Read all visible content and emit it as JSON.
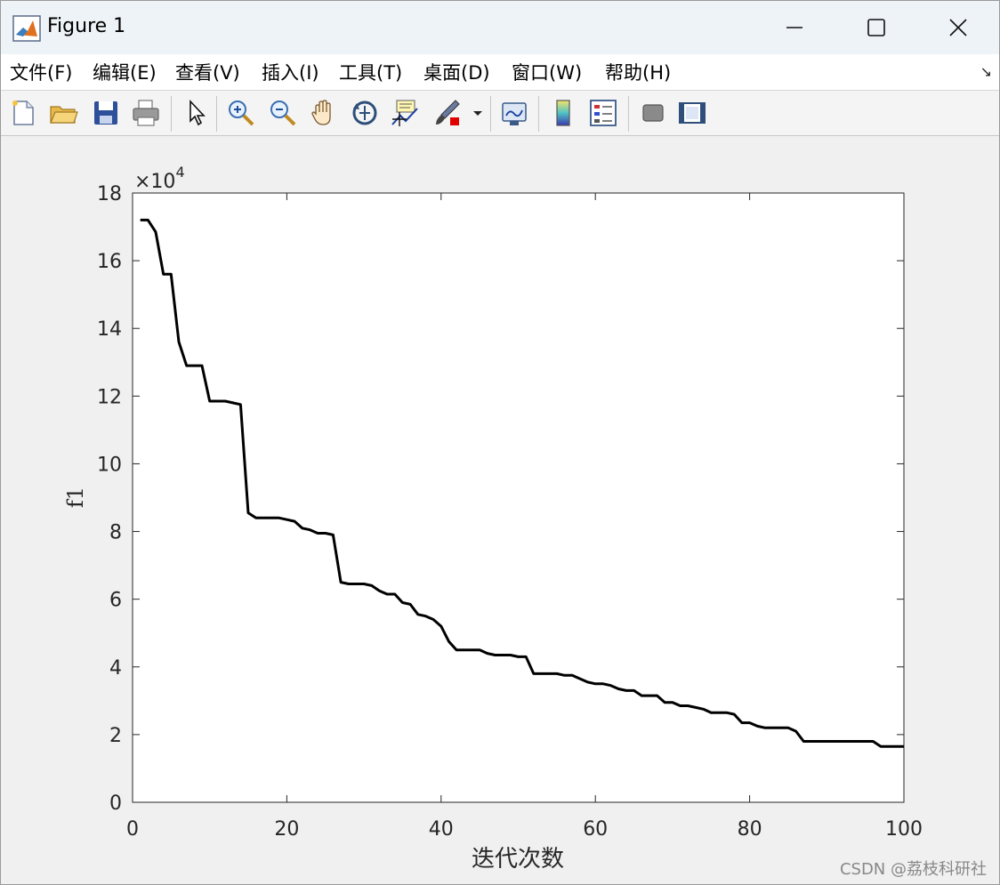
{
  "window": {
    "title": "Figure 1",
    "buttons": {
      "minimize": "minimize-icon",
      "maximize": "maximize-icon",
      "close": "close-icon"
    }
  },
  "menu": {
    "items": [
      {
        "label": "文件(F)"
      },
      {
        "label": "编辑(E)"
      },
      {
        "label": "查看(V)"
      },
      {
        "label": "插入(I)"
      },
      {
        "label": "工具(T)"
      },
      {
        "label": "桌面(D)"
      },
      {
        "label": "窗口(W)"
      },
      {
        "label": "帮助(H)"
      }
    ],
    "dock_arrow": "↘"
  },
  "toolbar": {
    "icons": [
      "new-file-icon",
      "open-folder-icon",
      "save-icon",
      "print-icon",
      "pointer-icon",
      "zoom-in-icon",
      "zoom-out-icon",
      "pan-hand-icon",
      "rotate-3d-icon",
      "data-cursor-icon",
      "brush-icon",
      "brush-dropdown-icon",
      "link-plot-icon",
      "colorbar-icon",
      "legend-icon",
      "hide-plot-tools-icon",
      "show-plot-tools-icon"
    ]
  },
  "chart_data": {
    "type": "line",
    "title": "",
    "xlabel": "迭代次数",
    "ylabel": "f1",
    "exponent_label": "×10",
    "exponent_power": "4",
    "xlim": [
      0,
      100
    ],
    "ylim": [
      0,
      18
    ],
    "xticks": [
      0,
      20,
      40,
      60,
      80,
      100
    ],
    "yticks": [
      0,
      2,
      4,
      6,
      8,
      10,
      12,
      14,
      16,
      18
    ],
    "line_color": "#000000",
    "series": [
      {
        "x": [
          1,
          2,
          3,
          4,
          5,
          6,
          7,
          8,
          9,
          10,
          11,
          12,
          13,
          14,
          15,
          16,
          17,
          18,
          19,
          20,
          21,
          22,
          23,
          24,
          25,
          26,
          27,
          28,
          29,
          30,
          31,
          32,
          33,
          34,
          35,
          36,
          37,
          38,
          39,
          40,
          41,
          42,
          43,
          44,
          45,
          46,
          47,
          48,
          49,
          50,
          51,
          52,
          53,
          54,
          55,
          56,
          57,
          58,
          59,
          60,
          61,
          62,
          63,
          64,
          65,
          66,
          67,
          68,
          69,
          70,
          71,
          72,
          73,
          74,
          75,
          76,
          77,
          78,
          79,
          80,
          81,
          82,
          83,
          84,
          85,
          86,
          87,
          88,
          89,
          90,
          91,
          92,
          93,
          94,
          95,
          96,
          97,
          98,
          99,
          100
        ],
        "values": [
          17.2,
          17.2,
          16.85,
          15.6,
          15.6,
          13.6,
          12.9,
          12.9,
          12.9,
          11.85,
          11.85,
          11.85,
          11.8,
          11.75,
          8.55,
          8.4,
          8.4,
          8.4,
          8.4,
          8.35,
          8.3,
          8.1,
          8.05,
          7.95,
          7.95,
          7.9,
          6.5,
          6.45,
          6.45,
          6.45,
          6.4,
          6.25,
          6.15,
          6.15,
          5.9,
          5.85,
          5.55,
          5.5,
          5.4,
          5.2,
          4.75,
          4.5,
          4.5,
          4.5,
          4.5,
          4.4,
          4.35,
          4.35,
          4.35,
          4.3,
          4.3,
          3.8,
          3.8,
          3.8,
          3.8,
          3.75,
          3.75,
          3.65,
          3.55,
          3.5,
          3.5,
          3.45,
          3.35,
          3.3,
          3.3,
          3.15,
          3.15,
          3.15,
          2.95,
          2.95,
          2.85,
          2.85,
          2.8,
          2.75,
          2.65,
          2.65,
          2.65,
          2.6,
          2.35,
          2.35,
          2.25,
          2.2,
          2.2,
          2.2,
          2.2,
          2.1,
          1.8,
          1.8,
          1.8,
          1.8,
          1.8,
          1.8,
          1.8,
          1.8,
          1.8,
          1.8,
          1.65,
          1.65,
          1.65,
          1.65
        ]
      }
    ]
  },
  "watermark": "CSDN @荔枝科研社"
}
